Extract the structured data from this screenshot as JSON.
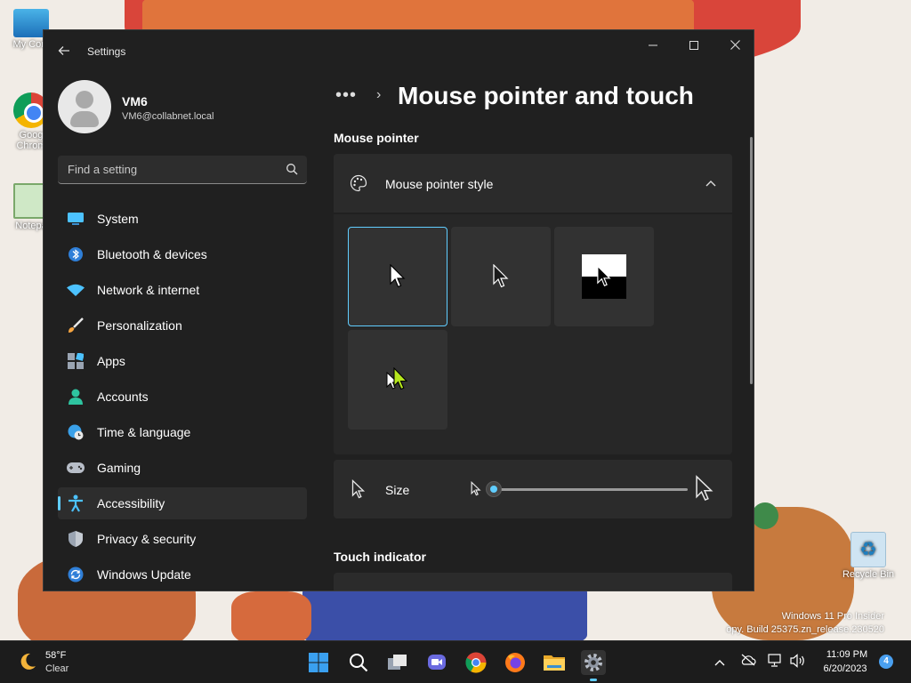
{
  "desktop": {
    "icons": [
      {
        "label": "My Com"
      },
      {
        "label": "Goog Chrom"
      },
      {
        "label": "Notepa"
      },
      {
        "label": "Recycle Bin"
      }
    ],
    "watermark": {
      "line1": "Windows 11 Pro Insider",
      "line2": "opy. Build 25375.zn_release.230520"
    }
  },
  "window": {
    "title": "Settings",
    "controls": {
      "minimize": "—",
      "maximize": "☐",
      "close": "✕"
    }
  },
  "user": {
    "name": "VM6",
    "email": "VM6@collabnet.local"
  },
  "search": {
    "placeholder": "Find a setting"
  },
  "nav": {
    "items": [
      {
        "label": "System",
        "icon": "monitor-icon"
      },
      {
        "label": "Bluetooth & devices",
        "icon": "bluetooth-icon"
      },
      {
        "label": "Network & internet",
        "icon": "wifi-icon"
      },
      {
        "label": "Personalization",
        "icon": "paintbrush-icon"
      },
      {
        "label": "Apps",
        "icon": "apps-icon"
      },
      {
        "label": "Accounts",
        "icon": "person-icon"
      },
      {
        "label": "Time & language",
        "icon": "globe-clock-icon"
      },
      {
        "label": "Gaming",
        "icon": "gamepad-icon"
      },
      {
        "label": "Accessibility",
        "icon": "accessibility-icon"
      },
      {
        "label": "Privacy & security",
        "icon": "shield-icon"
      },
      {
        "label": "Windows Update",
        "icon": "update-icon"
      }
    ],
    "selected": "Accessibility"
  },
  "breadcrumb": {
    "more": "•••",
    "separator": "›"
  },
  "page": {
    "title": "Mouse pointer and touch",
    "section_mouse_pointer": "Mouse pointer",
    "pointer_style": {
      "label": "Mouse pointer style",
      "expanded": true,
      "options": [
        "white",
        "black",
        "inverted",
        "custom"
      ],
      "selected": "white"
    },
    "size": {
      "label": "Size",
      "value_fraction": 0.0
    },
    "section_touch_indicator": "Touch indicator"
  },
  "colors": {
    "accent": "#60cdff",
    "window_bg": "#202020",
    "card_bg": "#2b2b2b",
    "custom_cursor": "#b5e61d"
  },
  "taskbar": {
    "weather": {
      "temp": "58°F",
      "desc": "Clear"
    },
    "clock": {
      "time": "11:09 PM",
      "date": "6/20/2023"
    },
    "notifications": "4"
  }
}
